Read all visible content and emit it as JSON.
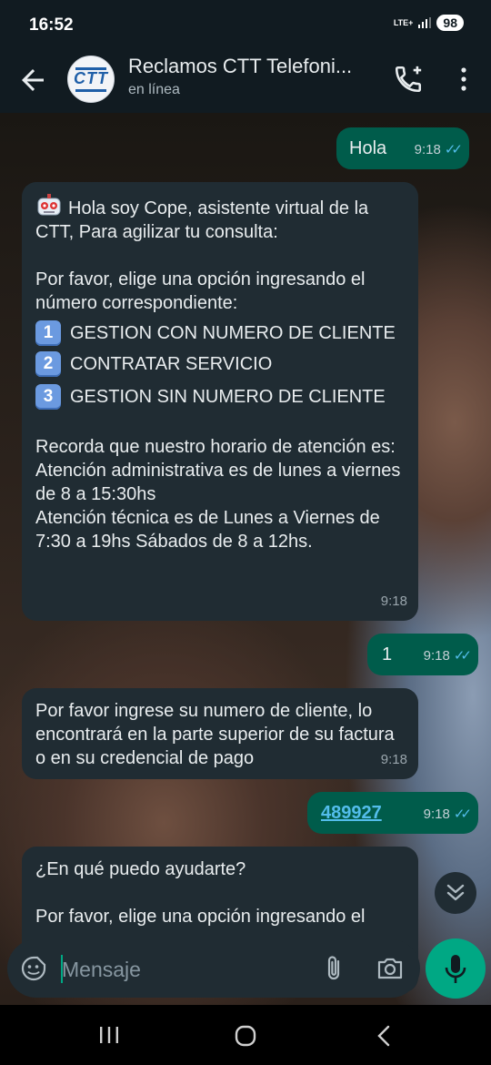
{
  "status_bar": {
    "time": "16:52",
    "network": "LTE+",
    "battery": "98"
  },
  "header": {
    "contact_name": "Reclamos CTT Telefoni...",
    "contact_status": "en línea",
    "avatar_text": "CTT"
  },
  "messages": [
    {
      "direction": "out",
      "text": "Hola",
      "time": "9:18"
    },
    {
      "direction": "in",
      "intro": "Hola soy Cope, asistente virtual de la CTT, Para agilizar tu consulta:",
      "prompt": "Por favor, elige una opción ingresando el número correspondiente:",
      "options": [
        {
          "key": "1",
          "text": "GESTION CON NUMERO DE CLIENTE"
        },
        {
          "key": "2",
          "text": "CONTRATAR SERVICIO"
        },
        {
          "key": "3",
          "text": "GESTION SIN NUMERO DE CLIENTE"
        }
      ],
      "hours": "Recorda que nuestro horario de atención es: Atención administrativa es de lunes a viernes de 8 a 15:30hs",
      "hours2": "Atención técnica es de Lunes a Viernes de 7:30 a 19hs Sábados de 8 a 12hs.",
      "time": "9:18"
    },
    {
      "direction": "out",
      "text": "1",
      "time": "9:18"
    },
    {
      "direction": "in",
      "text": "Por favor ingrese su numero de cliente, lo encontrará en la parte superior de su factura o en su credencial de pago",
      "time": "9:18"
    },
    {
      "direction": "out",
      "text": "489927",
      "time": "9:18"
    },
    {
      "direction": "in",
      "text": "¿En qué puedo ayudarte?",
      "text2": "Por favor, elige una opción ingresando el"
    }
  ],
  "composer": {
    "placeholder": "Mensaje"
  },
  "colors": {
    "outgoing": "#005c4b",
    "incoming": "#202c33",
    "accent": "#00a884",
    "ticks": "#53bdeb"
  },
  "icons": [
    "back-arrow-icon",
    "add-call-icon",
    "more-vert-icon",
    "robot-emoji-icon",
    "double-check-icon",
    "scroll-down-icon",
    "emoji-icon",
    "attach-icon",
    "camera-icon",
    "mic-icon"
  ]
}
